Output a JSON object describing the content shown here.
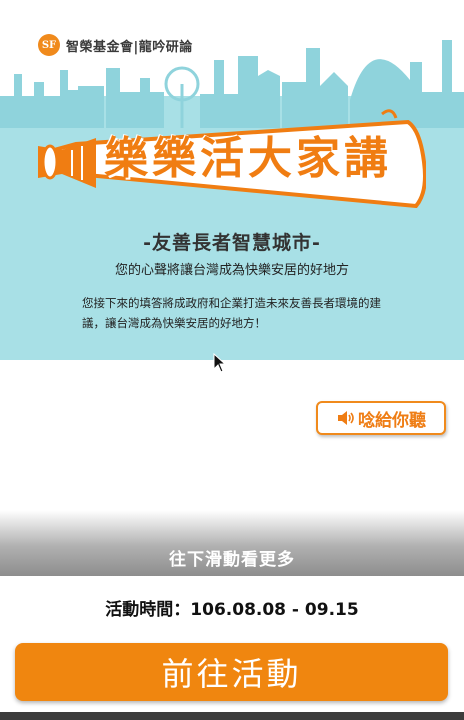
{
  "header": {
    "logo_mark": "SF",
    "org_name": "智榮基金會|龍吟研論"
  },
  "hero": {
    "title": "樂樂活大家講",
    "subtitle": "-友善長者智慧城市-",
    "tagline": "您的心聲將讓台灣成為快樂安居的好地方",
    "description": "您接下來的填答將成政府和企業打造未來友善長者環境的建議，讓台灣成為快樂安居的好地方！"
  },
  "audio_button": {
    "icon": "speaker-icon",
    "label": "唸給你聽"
  },
  "scroll_hint": "往下滑動看更多",
  "event": {
    "time_text": "活動時間：106.08.08 - 09.15"
  },
  "cta_label": "前往活動",
  "colors": {
    "accent": "#f0860f",
    "hero_bg": "#a8e0e6",
    "skyline": "#8fd3dc"
  }
}
